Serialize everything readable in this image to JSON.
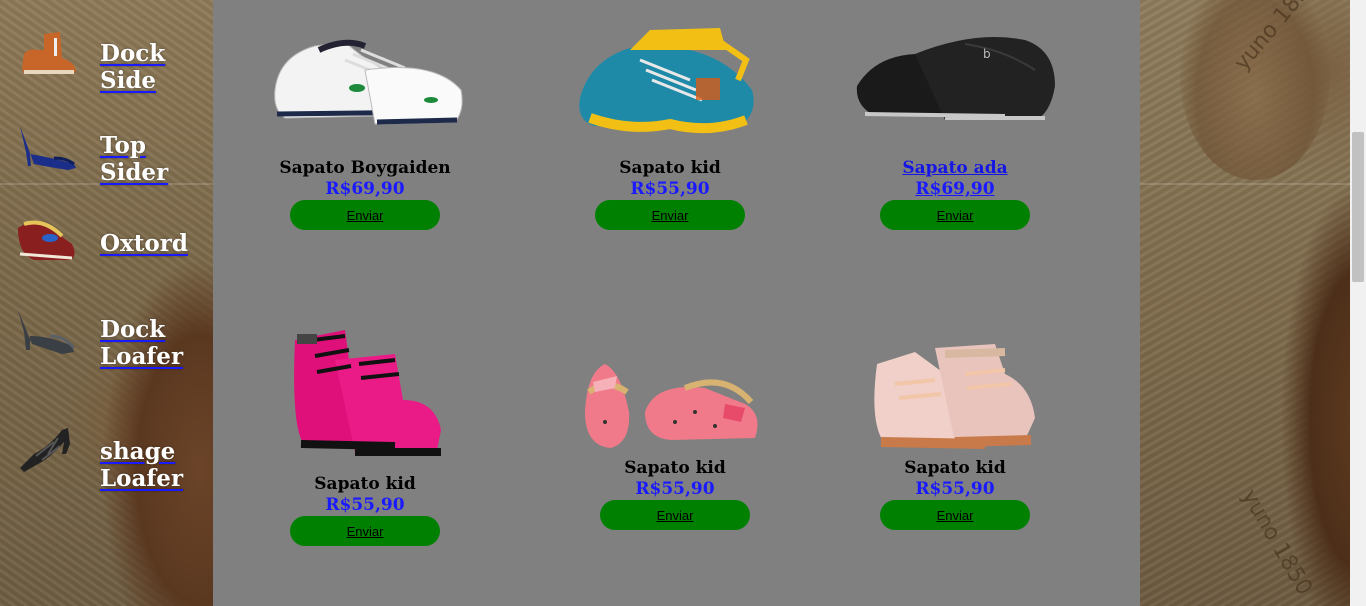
{
  "sidebar": {
    "items": [
      {
        "label": "Dock Side",
        "icon": "ankle-boot-icon"
      },
      {
        "label": "Top Sider",
        "icon": "blue-heel-icon"
      },
      {
        "label": "Oxtord",
        "icon": "loafer-icon"
      },
      {
        "label": "Dock Loafer",
        "icon": "platform-heel-icon"
      },
      {
        "label": "shage Loafer",
        "icon": "strappy-heel-icon"
      }
    ]
  },
  "products": [
    {
      "name": "Sapato Boygaiden",
      "price": "R$69,90",
      "button": "Enviar",
      "image": "white-sneaker-icon"
    },
    {
      "name": "Sapato kid",
      "price": "R$55,90",
      "button": "Enviar",
      "image": "blue-yellow-sneaker-icon"
    },
    {
      "name": "Sapato ada",
      "price": "R$69,90",
      "button": "Enviar",
      "image": "black-slipon-icon"
    },
    {
      "name": "Sapato kid",
      "price": "R$55,90",
      "button": "Enviar",
      "image": "pink-boot-icon"
    },
    {
      "name": "Sapato kid",
      "price": "R$55,90",
      "button": "Enviar",
      "image": "pink-flats-icon"
    },
    {
      "name": "Sapato kid",
      "price": "R$55,90",
      "button": "Enviar",
      "image": "rose-gold-sneaker-icon"
    }
  ],
  "colors": {
    "panel": "#808080",
    "button": "#008000",
    "price": "#1a1aff",
    "menu_text": "#ffffff"
  }
}
